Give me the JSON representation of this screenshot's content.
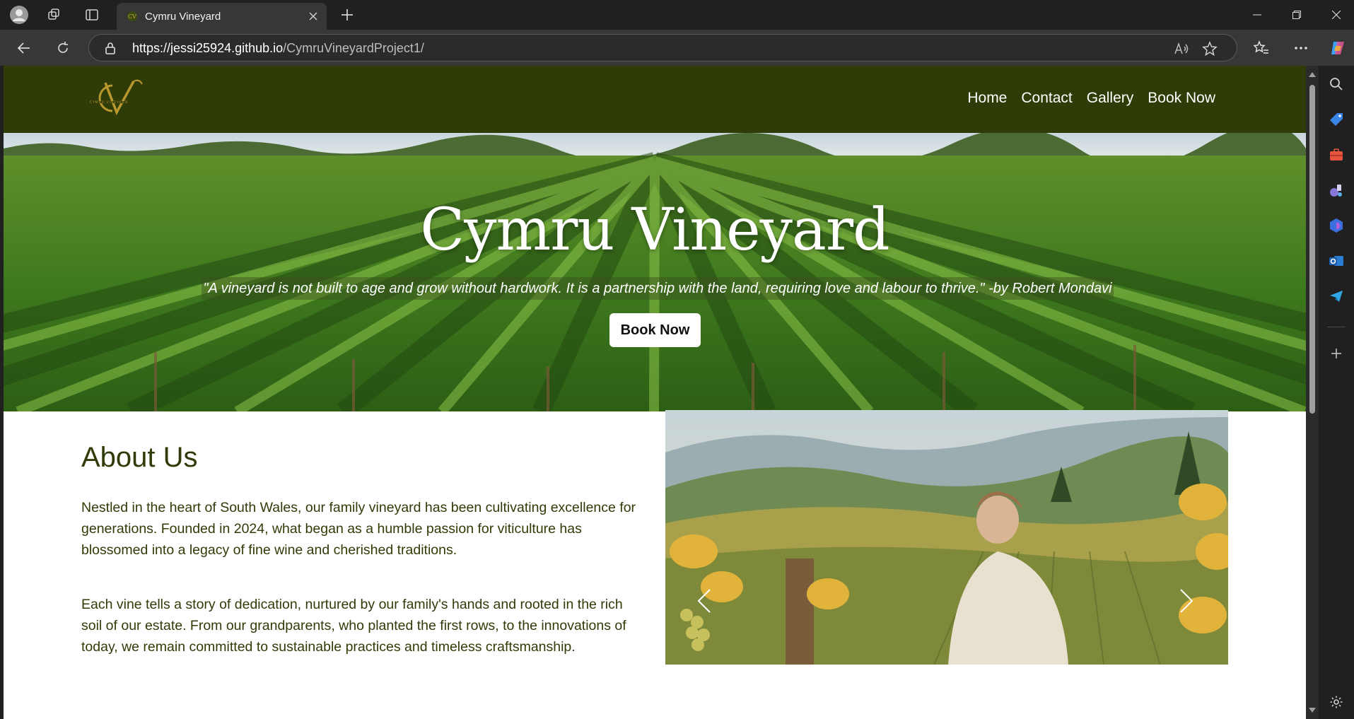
{
  "browser": {
    "tab_title": "Cymru Vineyard",
    "url_host": "https://jessi25924.github.io",
    "url_path": "/CymruVineyardProject1/"
  },
  "site": {
    "nav": [
      "Home",
      "Contact",
      "Gallery",
      "Book Now"
    ],
    "hero_title": "Cymru Vineyard",
    "hero_quote": "\"A vineyard is not built to age and grow without hardwork. It is a partnership with the land, requiring love and labour to thrive.\" -by Robert Mondavi",
    "hero_button": "Book Now",
    "about_title": "About Us",
    "about_p1": "Nestled in the heart of South Wales, our family vineyard has been cultivating excellence for generations. Founded in 2024, what began as a humble passion for viticulture has blossomed into a legacy of fine wine and cherished traditions.",
    "about_p2": "Each vine tells a story of dedication, nurtured by our family's hands and rooted in the rich soil of our estate. From our grandparents, who planted the first rows, to the innovations of today, we remain committed to sustainable practices and timeless craftsmanship."
  },
  "colors": {
    "header_green": "#303c08",
    "logo_gold": "#b8972e"
  }
}
